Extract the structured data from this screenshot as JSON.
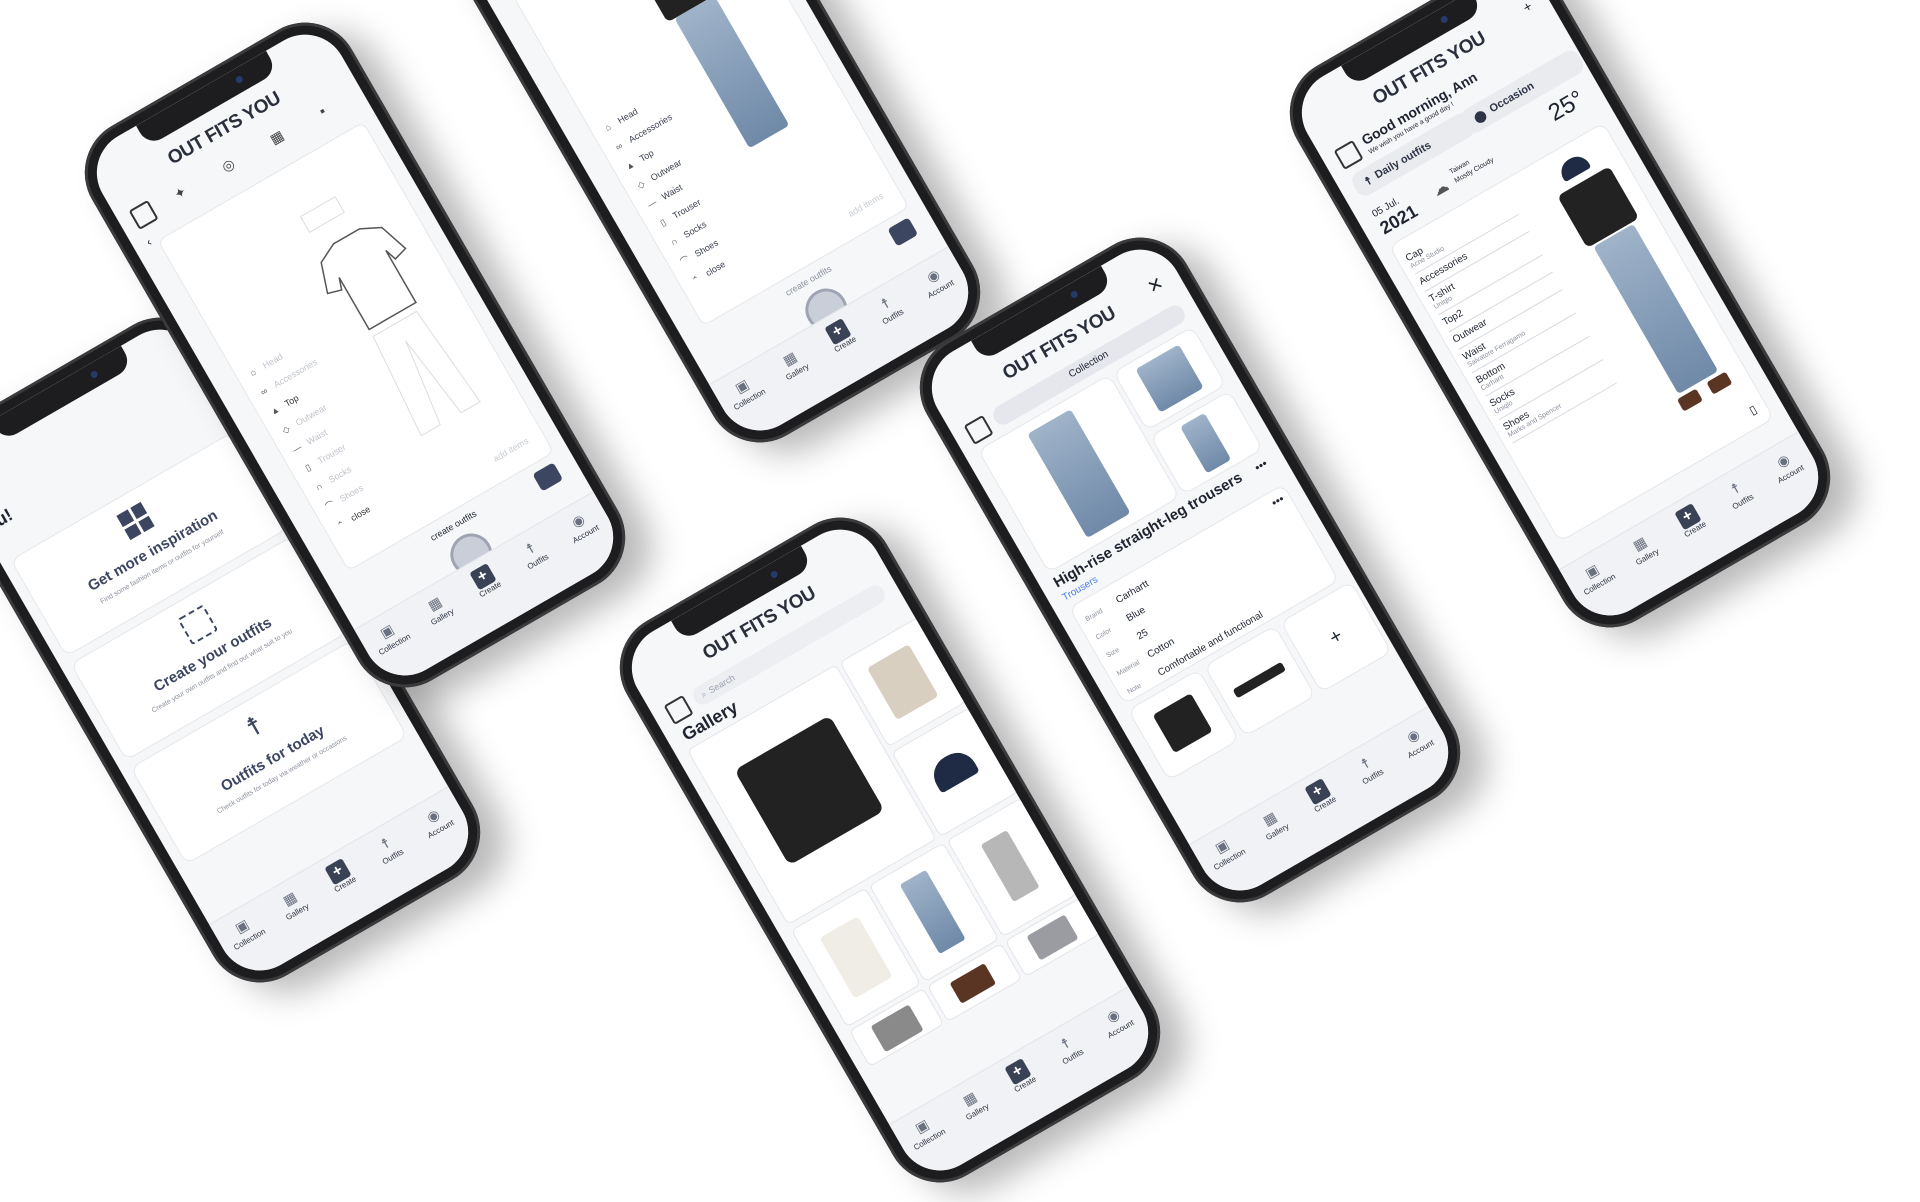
{
  "brand": "OUT FITS YOU",
  "tabs": [
    {
      "label": "Collection",
      "icon": "collection-icon"
    },
    {
      "label": "Gallery",
      "icon": "gallery-icon"
    },
    {
      "label": "Create",
      "icon": "plus-icon"
    },
    {
      "label": "Outfits",
      "icon": "person-icon"
    },
    {
      "label": "Account",
      "icon": "account-icon"
    }
  ],
  "welcome": {
    "headline_partial": "o you!",
    "cards": [
      {
        "title": "Get more inspiration",
        "subtitle": "Find some fashion items or outfits for yourself",
        "icon": "grid-icon"
      },
      {
        "title": "Create your outfits",
        "subtitle": "Create your own outfits and find out what suit to you",
        "icon": "scan-icon"
      },
      {
        "title": "Outfits for today",
        "subtitle": "Check outfits for today via weather or occasions",
        "icon": "person-icon"
      }
    ]
  },
  "creator": {
    "categories": [
      "Head",
      "Accessories",
      "Top",
      "Outwear",
      "Waist",
      "Trouser",
      "Socks",
      "Shoes"
    ],
    "close_label": "close",
    "add_items": "add items",
    "create_outfits": "create outfits"
  },
  "creator2": {
    "categories": [
      "Head",
      "Accessories",
      "Top",
      "Outwear",
      "Waist",
      "Trouser",
      "Socks",
      "Shoes"
    ],
    "close_label": "close",
    "add_items": "add items",
    "create_outfits": "create outfits"
  },
  "gallery": {
    "search_placeholder": "Search",
    "title": "Gallery"
  },
  "item": {
    "tab": "Collection",
    "title": "High-rise straight-leg trousers",
    "category": "Trousers",
    "fields": [
      {
        "label": "Brand",
        "value": "Carhartt"
      },
      {
        "label": "Color",
        "value": "Blue"
      },
      {
        "label": "Size",
        "value": "25"
      },
      {
        "label": "Material",
        "value": "Cotton"
      },
      {
        "label": "Note",
        "value": "Comfortable and functional"
      }
    ],
    "add_symbol": "+"
  },
  "daily": {
    "greeting": "Good morning, Ann",
    "subgreeting": "We wish you have a good day !",
    "pills": [
      "Daily outfits",
      "Occasion"
    ],
    "date_day": "05 Jul.",
    "date_year": "2021",
    "location": "Taiwan",
    "weather": "Mostly Cloudy",
    "temperature": "25°",
    "items": [
      {
        "name": "Cap",
        "brand": "Acne Studio"
      },
      {
        "name": "Accessories",
        "brand": ""
      },
      {
        "name": "T-shirt",
        "brand": "Uniqlo"
      },
      {
        "name": "Top2",
        "brand": ""
      },
      {
        "name": "Outwear",
        "brand": ""
      },
      {
        "name": "Waist",
        "brand": "Salvatore Ferragamo"
      },
      {
        "name": "Bottom",
        "brand": "Carhartt"
      },
      {
        "name": "Socks",
        "brand": "Uniqlo"
      },
      {
        "name": "Shoes",
        "brand": "Marks and Spencer"
      }
    ],
    "plus": "+"
  }
}
